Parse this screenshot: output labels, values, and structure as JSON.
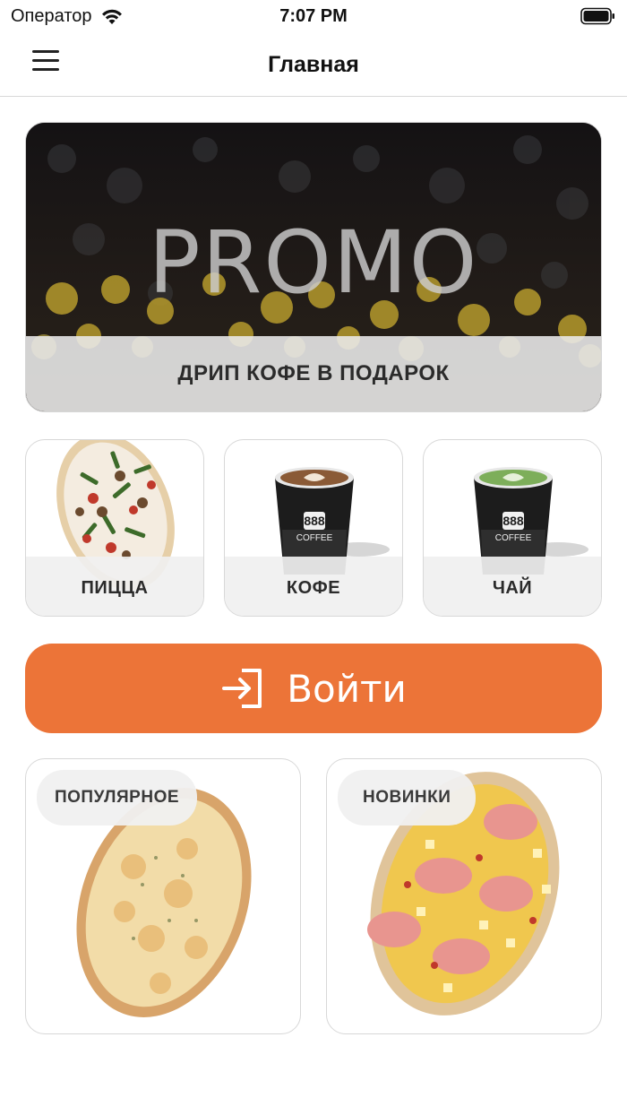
{
  "status_bar": {
    "carrier": "Оператор",
    "time": "7:07 PM",
    "icons": [
      "wifi-icon",
      "battery-icon"
    ]
  },
  "nav": {
    "title": "Главная",
    "menu_icon": "hamburger-menu-icon"
  },
  "promo": {
    "word": "PROMO",
    "caption": "ДРИП КОФЕ В ПОДАРОК"
  },
  "categories": [
    {
      "label": "ПИЦЦА",
      "image": "pizza-image"
    },
    {
      "label": "КОФЕ",
      "image": "coffee-cup-image"
    },
    {
      "label": "ЧАЙ",
      "image": "matcha-cup-image"
    }
  ],
  "cup_brand": {
    "line1": "888",
    "line2": "COFFEE"
  },
  "login": {
    "label": "Войти",
    "icon": "login-arrow-icon"
  },
  "cards": [
    {
      "badge": "ПОПУЛЯРНОЕ",
      "image": "cheese-pizza-image"
    },
    {
      "badge": "НОВИНКИ",
      "image": "ham-pineapple-pizza-image"
    }
  ],
  "colors": {
    "accent": "#ec7438",
    "tile_label_bg": "#f0f0f0",
    "promo_bg": "#181416"
  }
}
